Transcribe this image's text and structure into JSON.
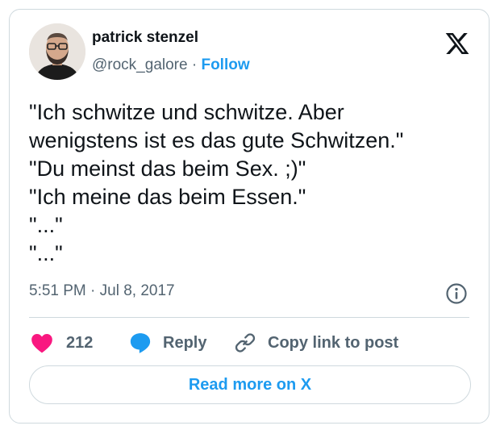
{
  "author": {
    "name": "patrick stenzel",
    "handle": "@rock_galore",
    "separator": " · ",
    "follow_label": "Follow",
    "avatar_icon": "profile-photo"
  },
  "brand": {
    "logo_icon": "x-logo-icon"
  },
  "tweet": {
    "lines": [
      "\"Ich schwitze und schwitze. Aber",
      "wenigstens ist es das gute Schwitzen.\"",
      "\"Du meinst das beim Sex. ;)\"",
      "\"Ich meine das beim Essen.\"",
      "\"...\"",
      "\"...\""
    ],
    "timestamp": "5:51 PM · Jul 8, 2017"
  },
  "actions": {
    "like_count": "212",
    "reply_label": "Reply",
    "copy_label": "Copy link to post",
    "read_more_label": "Read more on X"
  },
  "colors": {
    "accent": "#1d9bf0",
    "like": "#f91880",
    "text": "#0f1419",
    "muted": "#536471",
    "border": "#cfd9de"
  }
}
